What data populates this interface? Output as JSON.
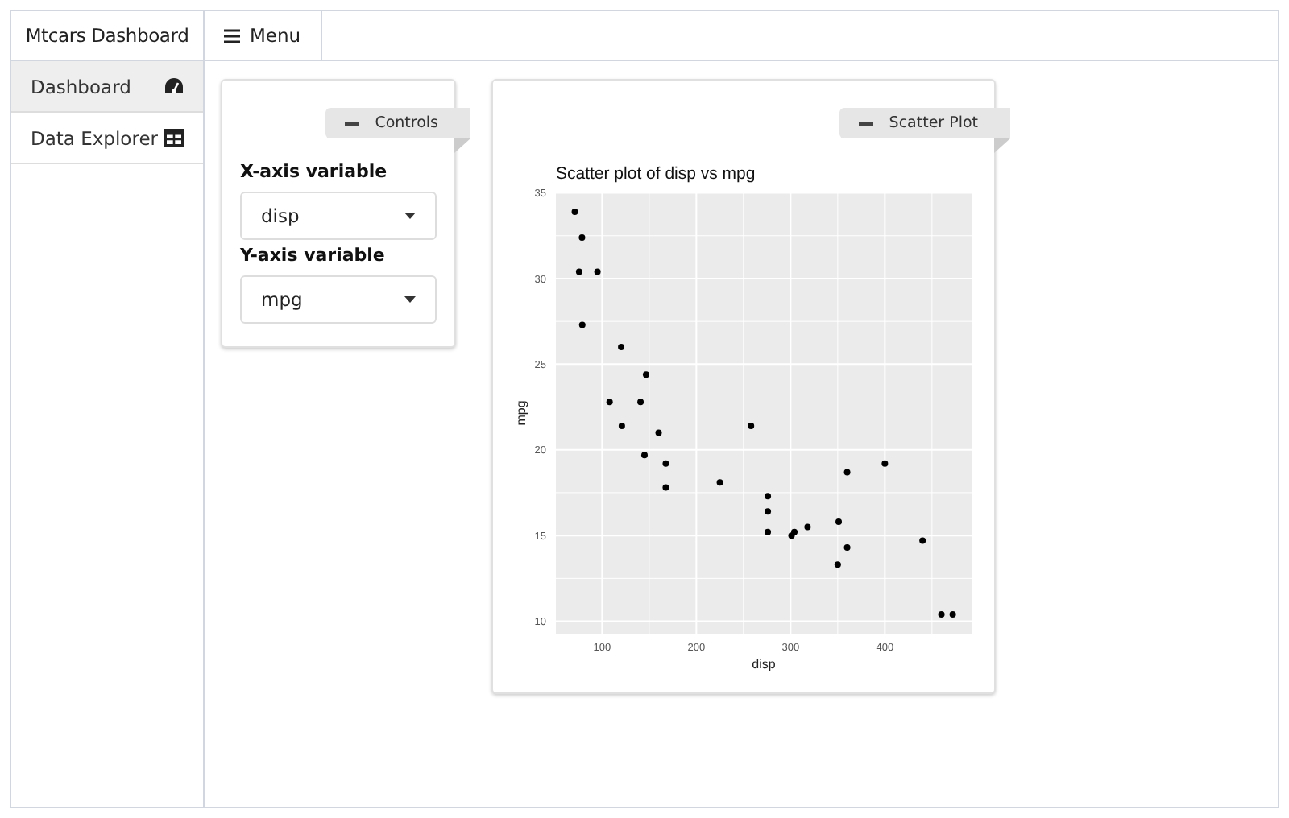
{
  "header": {
    "brand": "Mtcars Dashboard",
    "menu_button": "Menu"
  },
  "sidebar": {
    "items": [
      {
        "label": "Dashboard",
        "kind": "gauge",
        "selected": true
      },
      {
        "label": "Data Explorer",
        "kind": "table",
        "selected": false
      }
    ]
  },
  "controls": {
    "title": "Controls",
    "fields": [
      {
        "label": "X-axis variable",
        "value": "disp"
      },
      {
        "label": "Y-axis variable",
        "value": "mpg"
      }
    ]
  },
  "scatter": {
    "title": "Scatter Plot",
    "chart_data": {
      "type": "scatter",
      "title": "Scatter plot of disp vs mpg",
      "xlabel": "disp",
      "ylabel": "mpg",
      "x": [
        160,
        108,
        258,
        360,
        225,
        360,
        146.7,
        140.8,
        167.6,
        167.6,
        275.8,
        275.8,
        275.8,
        472,
        460,
        440,
        78.7,
        75.7,
        71.1,
        318,
        304,
        350,
        400,
        79,
        120.3,
        95.1,
        351,
        145,
        301,
        121
      ],
      "grid": true,
      "series": [
        {
          "color": "#000000",
          "values": [
            21,
            22.8,
            21.4,
            18.7,
            18.1,
            14.3,
            24.4,
            22.8,
            19.2,
            17.8,
            16.4,
            17.3,
            15.2,
            10.4,
            10.4,
            14.7,
            32.4,
            30.4,
            33.9,
            15.5,
            15.2,
            13.3,
            19.2,
            27.3,
            26,
            30.4,
            15.8,
            19.7,
            15,
            21.4
          ]
        }
      ],
      "xlim": [
        51,
        492
      ],
      "ylim": [
        9.225,
        35.075
      ],
      "xticks": [
        100,
        200,
        300,
        400
      ],
      "yticks": [
        10,
        15,
        20,
        25,
        30,
        35
      ]
    }
  }
}
